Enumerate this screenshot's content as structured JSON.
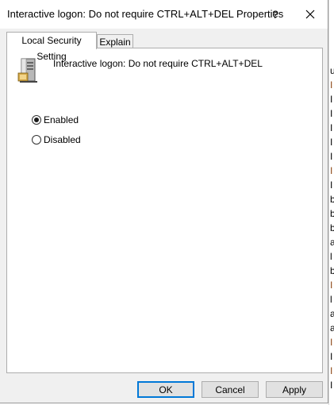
{
  "dialog": {
    "title": "Interactive logon: Do not require CTRL+ALT+DEL Properties",
    "help_label": "?",
    "tabs": [
      {
        "label": "Local Security Setting",
        "active": true
      },
      {
        "label": "Explain",
        "active": false
      }
    ],
    "policy_name": "Interactive logon: Do not require CTRL+ALT+DEL",
    "options": [
      {
        "label": "Enabled",
        "selected": true
      },
      {
        "label": "Disabled",
        "selected": false
      }
    ],
    "buttons": {
      "ok": "OK",
      "cancel": "Cancel",
      "apply": "Apply"
    }
  },
  "background_window": {
    "row_chars": [
      "u",
      "I",
      "I",
      "I",
      "I",
      "I",
      "I",
      "I",
      "I",
      "b",
      "b",
      "b",
      "a",
      "l",
      "b",
      "I",
      "l",
      "a",
      "a",
      "I",
      "I",
      "I",
      "I"
    ],
    "highlight_rows": [
      1,
      7,
      15,
      19,
      21
    ]
  },
  "colors": {
    "accent": "#0078d7",
    "dialog_bg": "#f0f0f0",
    "panel_bg": "#ffffff",
    "button_bg": "#e1e1e1",
    "bg_row_highlight": "#8b4513"
  },
  "icons": {
    "policy": "server-icon",
    "close": "close-icon"
  }
}
